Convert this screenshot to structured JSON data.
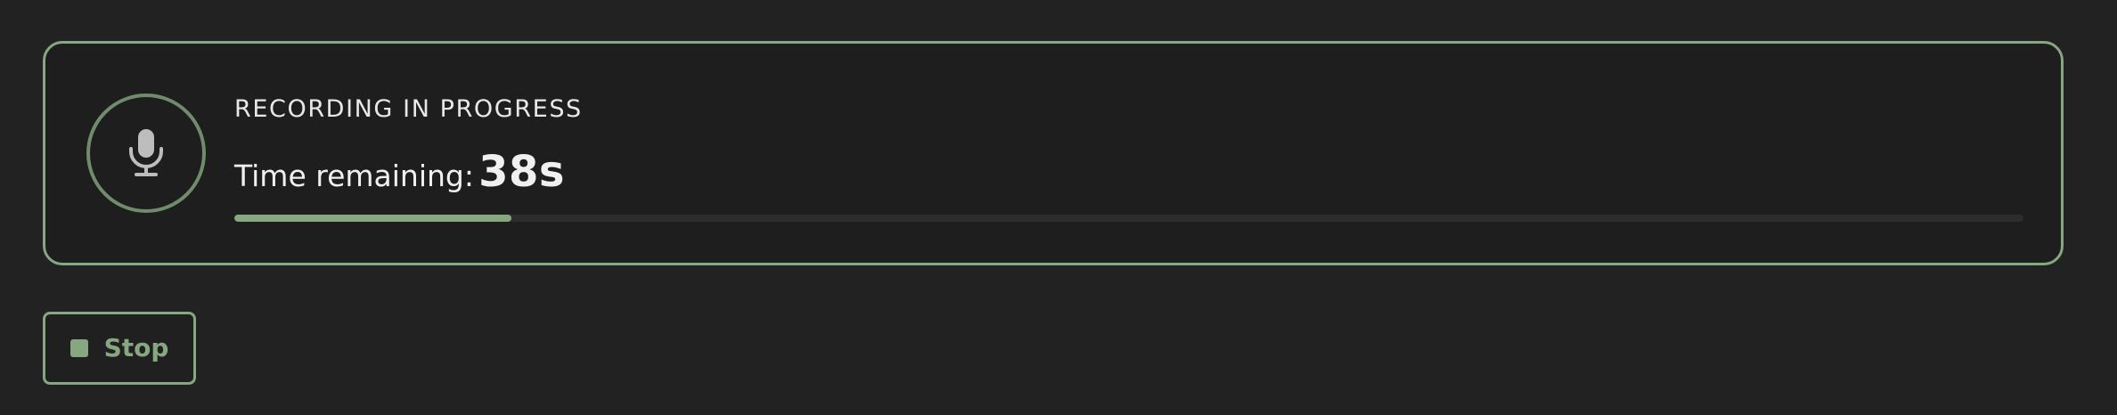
{
  "recording": {
    "status_label": "RECORDING IN PROGRESS",
    "time_label": "Time remaining:",
    "time_value": "38s",
    "progress_fraction": 0.155
  },
  "controls": {
    "stop_label": "Stop"
  },
  "icons": {
    "status": "microphone-icon",
    "stop": "stop-square-icon"
  },
  "colors": {
    "accent": "#86a77f",
    "ring": "#6f8c6b",
    "background": "#222222",
    "text": "#e8e8e8"
  }
}
